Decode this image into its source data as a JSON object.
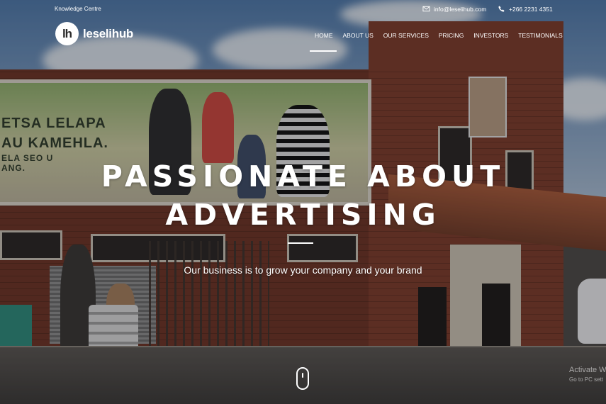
{
  "topbar": {
    "left_link": "Knowledge Centre",
    "email": "info@leselihub.com",
    "phone": "+266 2231 4351"
  },
  "brand": {
    "logo_mark": "lh",
    "name": "leselihub"
  },
  "nav": {
    "items": [
      {
        "label": "HOME",
        "active": true
      },
      {
        "label": "ABOUT US"
      },
      {
        "label": "OUR SERVICES"
      },
      {
        "label": "PRICING"
      },
      {
        "label": "INVESTORS"
      },
      {
        "label": "TESTIMONIALS"
      }
    ]
  },
  "hero": {
    "title_line1": "PASSIONATE ABOUT",
    "title_line2": "ADVERTISING",
    "subtitle": "Our business is to grow your company and your brand"
  },
  "billboard": {
    "line1": "ETSA LELAPA",
    "line2": "AU KAMEHLA.",
    "line3": "ELA SEO U",
    "line4": "ANG."
  },
  "watermark": {
    "line1": "Activate W",
    "line2": "Go to PC sett"
  },
  "icons": {
    "email": "envelope-icon",
    "phone": "phone-icon",
    "scroll": "mouse-scroll-icon"
  },
  "colors": {
    "text": "#ffffff",
    "brick": "#7a3b2a"
  }
}
